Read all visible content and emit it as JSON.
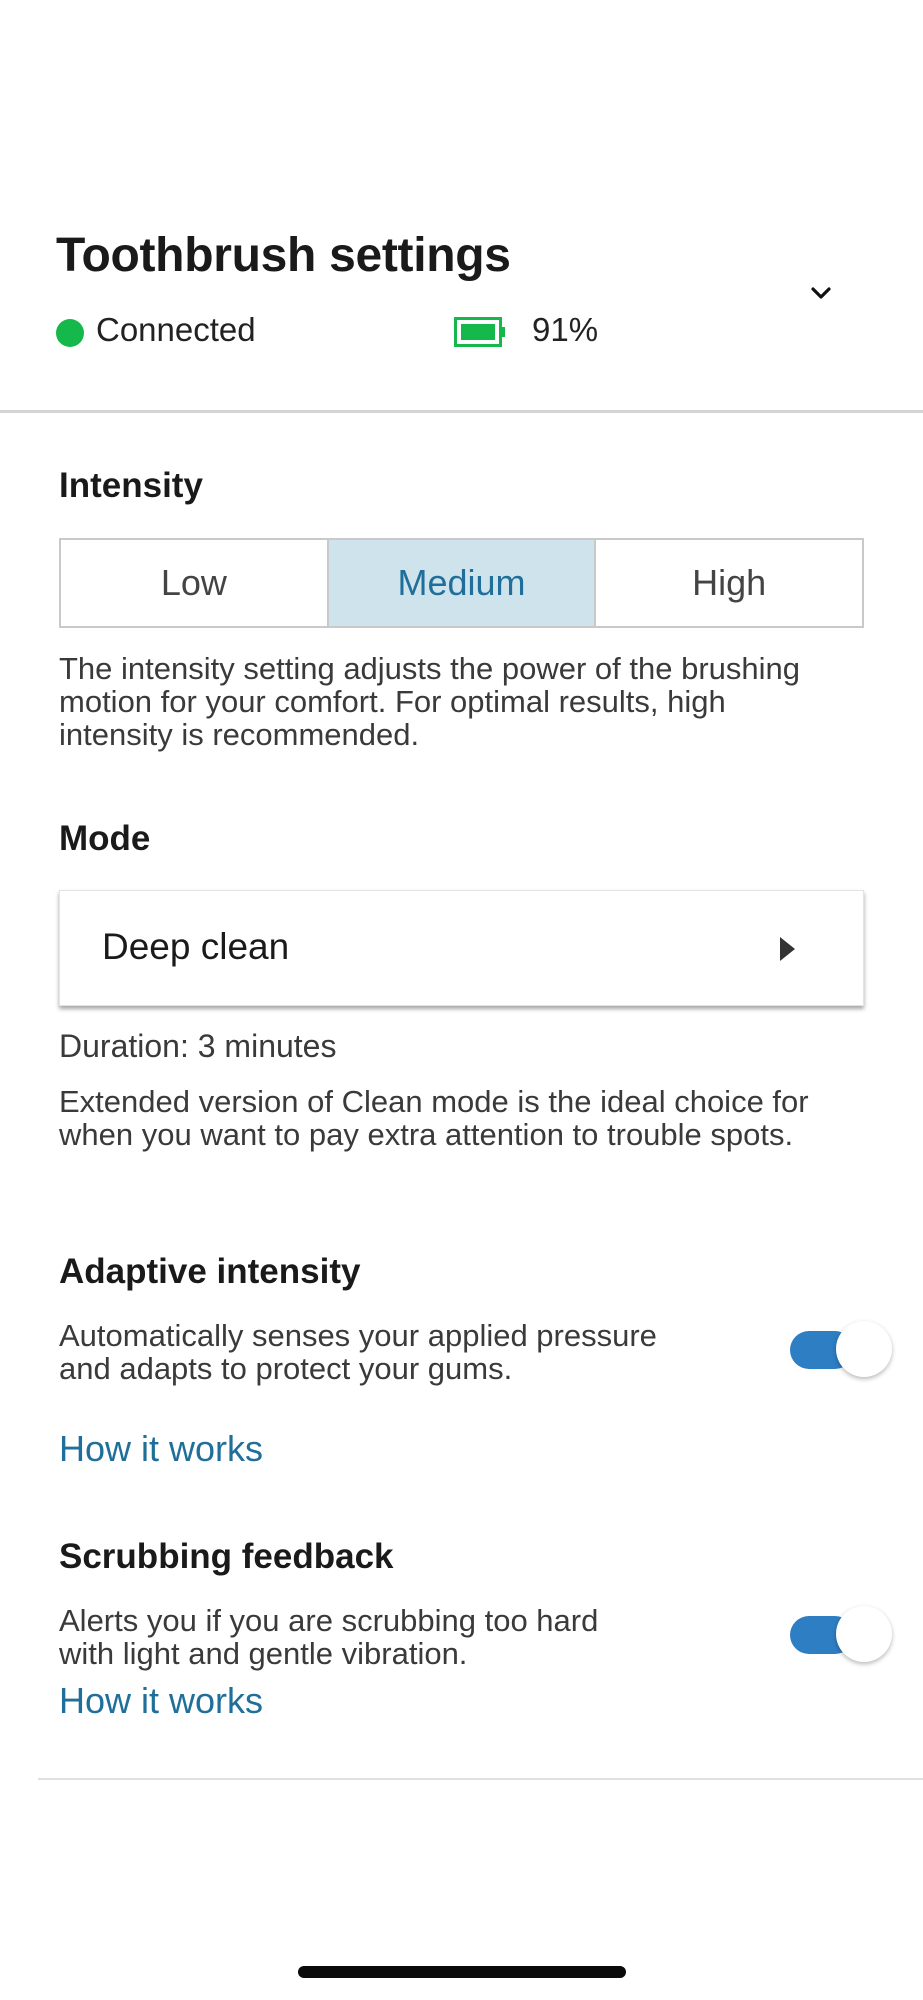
{
  "header": {
    "title": "Toothbrush settings",
    "connection_status": "Connected",
    "battery_level": "91%",
    "connection_color": "#15b84a",
    "battery_color": "#15b84a",
    "expand_icon": "chevron-down-icon"
  },
  "intensity": {
    "title": "Intensity",
    "options": [
      "Low",
      "Medium",
      "High"
    ],
    "selected": "Medium",
    "description": "The intensity setting adjusts the power of the brushing motion for your comfort. For optimal results, high intensity is recommended."
  },
  "mode": {
    "title": "Mode",
    "selected": "Deep clean",
    "duration": "Duration: 3 minutes",
    "description": "Extended version of Clean mode is the ideal choice for when you want to pay extra attention to trouble spots.",
    "arrow_icon": "triangle-right-icon"
  },
  "adaptive_intensity": {
    "title": "Adaptive intensity",
    "description": "Automatically senses your applied pressure and adapts to protect your gums.",
    "link": "How it works",
    "enabled": true
  },
  "scrubbing_feedback": {
    "title": "Scrubbing feedback",
    "description": "Alerts you if you are scrubbing too hard with light and gentle vibration.",
    "link": "How it works",
    "enabled": true
  },
  "colors": {
    "accent": "#2e7ec4",
    "link": "#1f6f9a",
    "selected_segment_bg": "#cfe3ec"
  }
}
